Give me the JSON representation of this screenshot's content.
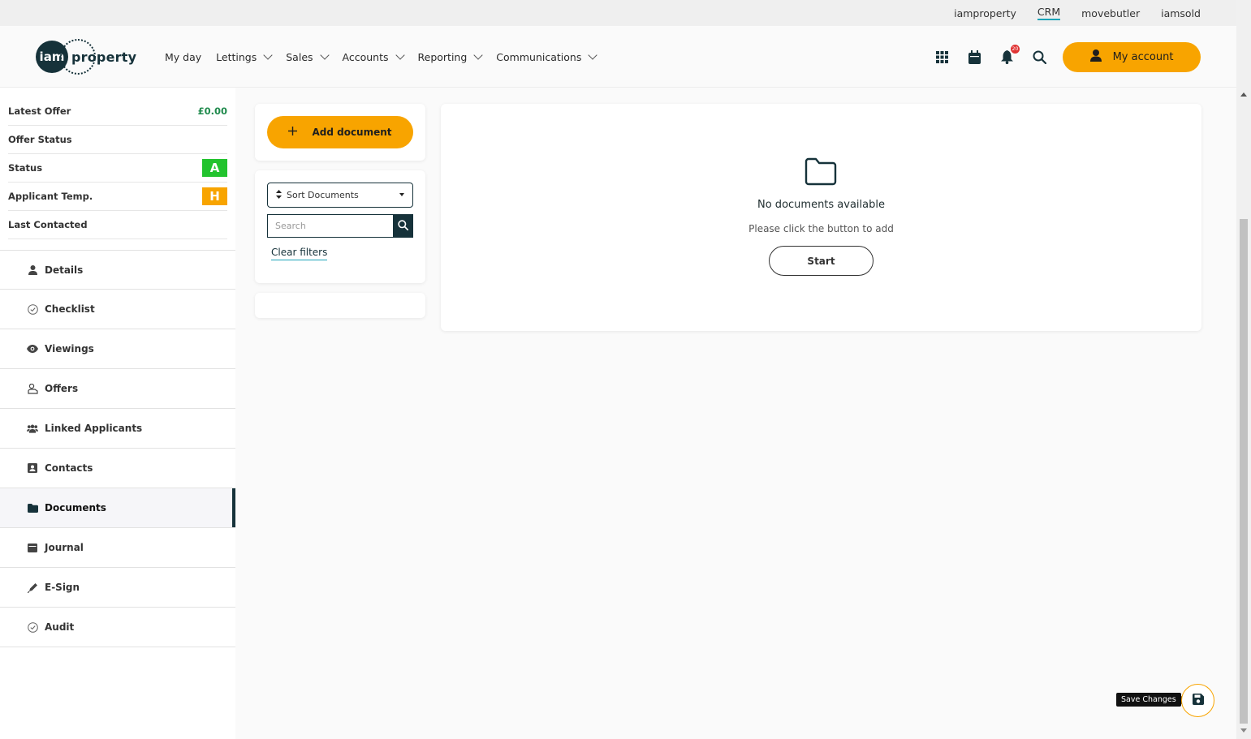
{
  "topbar": {
    "links": [
      {
        "label": "iamproperty"
      },
      {
        "label": "CRM",
        "active": true
      },
      {
        "label": "movebutler"
      },
      {
        "label": "iamsold"
      }
    ]
  },
  "header": {
    "logo_mark": "iam",
    "logo_word": "property",
    "nav": [
      {
        "label": "My day",
        "dropdown": false
      },
      {
        "label": "Lettings",
        "dropdown": true
      },
      {
        "label": "Sales",
        "dropdown": true
      },
      {
        "label": "Accounts",
        "dropdown": true
      },
      {
        "label": "Reporting",
        "dropdown": true
      },
      {
        "label": "Communications",
        "dropdown": true
      }
    ],
    "icons": [
      "apps-grid-icon",
      "calendar-icon",
      "bell-icon",
      "search-icon"
    ],
    "notification_count": "20",
    "account_label": "My account"
  },
  "summary": {
    "latest_offer_label": "Latest Offer",
    "latest_offer_value": "£0.00",
    "offer_status_label": "Offer Status",
    "status_label": "Status",
    "status_value": "A",
    "status_color": "#22c32e",
    "applicant_temp_label": "Applicant Temp.",
    "applicant_temp_value": "H",
    "applicant_temp_color": "#f8a400",
    "last_contacted_label": "Last Contacted"
  },
  "menu": [
    {
      "label": "Details",
      "icon": "person-icon"
    },
    {
      "label": "Checklist",
      "icon": "check-circle-icon"
    },
    {
      "label": "Viewings",
      "icon": "eye-icon"
    },
    {
      "label": "Offers",
      "icon": "offer-icon"
    },
    {
      "label": "Linked Applicants",
      "icon": "users-icon"
    },
    {
      "label": "Contacts",
      "icon": "contact-card-icon"
    },
    {
      "label": "Documents",
      "icon": "folder-icon",
      "active": true
    },
    {
      "label": "Journal",
      "icon": "journal-icon"
    },
    {
      "label": "E-Sign",
      "icon": "pen-icon"
    },
    {
      "label": "Audit",
      "icon": "check-circle-icon"
    }
  ],
  "documents": {
    "add_label": "Add document",
    "sort_label": "Sort Documents",
    "search_placeholder": "Search",
    "clear_filters": "Clear filters",
    "empty_title": "No documents available",
    "empty_subtitle": "Please click the button to add",
    "start_label": "Start"
  },
  "save": {
    "tooltip": "Save Changes"
  },
  "colors": {
    "accent": "#f8a400",
    "brand": "#16323a",
    "link_underline": "#1aa3b8"
  }
}
